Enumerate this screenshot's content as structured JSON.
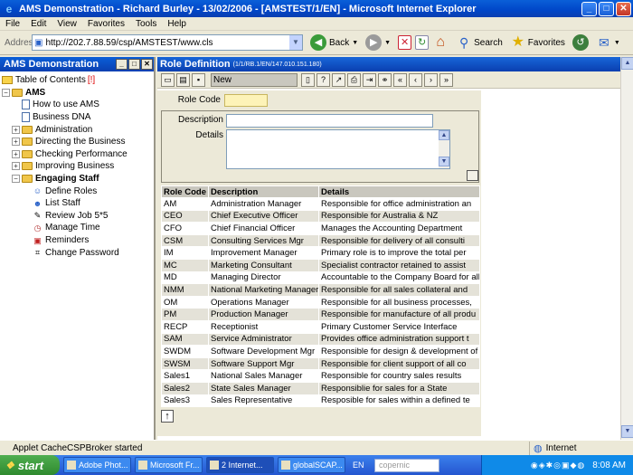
{
  "window": {
    "title": "AMS Demonstration - Richard Burley - 13/02/2006 - [AMSTEST/1/EN] - Microsoft Internet Explorer",
    "min": "_",
    "max": "□",
    "close": "✕"
  },
  "menu": [
    "File",
    "Edit",
    "View",
    "Favorites",
    "Tools",
    "Help"
  ],
  "address": {
    "label": "Address",
    "url": "http://202.7.88.59/csp/AMSTEST/www.cls"
  },
  "toolbar": {
    "back": "Back",
    "search": "Search",
    "favorites": "Favorites"
  },
  "left_pane": {
    "title": "AMS Demonstration",
    "toc_label": "Table of Contents",
    "toc_marker": "[!]",
    "root": "AMS",
    "items": [
      {
        "label": "How to use AMS",
        "kind": "doc"
      },
      {
        "label": "Business DNA",
        "kind": "doc"
      },
      {
        "label": "Administration",
        "kind": "folder"
      },
      {
        "label": "Directing the Business",
        "kind": "folder"
      },
      {
        "label": "Checking Performance",
        "kind": "folder"
      },
      {
        "label": "Improving Business",
        "kind": "folder"
      }
    ],
    "open_section": "Engaging Staff",
    "sub_items": [
      "Define Roles",
      "List Staff",
      "Review Job 5*5",
      "Manage Time",
      "Reminders",
      "Change Password"
    ]
  },
  "role_def": {
    "title": "Role Definition",
    "subtitle": "(1/1/RB.1/EN/147.010.151.180)",
    "mode": "New",
    "fields": {
      "role_code": "Role Code",
      "description": "Description",
      "details": "Details"
    },
    "columns": [
      "Role Code",
      "Description",
      "Details"
    ],
    "rows": [
      [
        "AM",
        "Administration Manager",
        "Responsible for office administration an"
      ],
      [
        "CEO",
        "Chief Executive Officer",
        "Responsible for Australia & NZ"
      ],
      [
        "CFO",
        "Chief Financial Officer",
        "Manages the Accounting Department"
      ],
      [
        "CSM",
        "Consulting Services Mgr",
        "Responsible for delivery of all consulti"
      ],
      [
        "IM",
        "Improvement Manager",
        "Primary role is to improve the total per"
      ],
      [
        "MC",
        "Marketing Consultant",
        "Specialist contractor retained to assist"
      ],
      [
        "MD",
        "Managing Director",
        "Accountable to the Company Board for all"
      ],
      [
        "NMM",
        "National Marketing Manager",
        "Responsible for all sales collateral and"
      ],
      [
        "OM",
        "Operations Manager",
        "Responsible for all business processes,"
      ],
      [
        "PM",
        "Production Manager",
        "Responsible for manufacture of all produ"
      ],
      [
        "RECP",
        "Receptionist",
        "Primary Customer Service Interface"
      ],
      [
        "SAM",
        "Service Administrator",
        "Provides office administration support t"
      ],
      [
        "SWDM",
        "Software Development Mgr",
        "Responsible for design & development of"
      ],
      [
        "SWSM",
        "Software Support Mgr",
        "Responsible for client support of all co"
      ],
      [
        "Sales1",
        "National Sales Manager",
        "Responsible for country sales results"
      ],
      [
        "Sales2",
        "State Sales Manager",
        "Responsiblie for sales for a State"
      ],
      [
        "Sales3",
        "Sales Representative",
        "Resposible for sales within a defined te"
      ]
    ]
  },
  "status": {
    "text": "Applet CacheCSPBroker started",
    "zone": "Internet"
  },
  "taskbar": {
    "start": "start",
    "tasks": [
      "Adobe Phot...",
      "Microsoft Fr...",
      "2 Internet...",
      "globalSCAP..."
    ],
    "lang": "EN",
    "search_placeholder": "copernic",
    "clock": "8:08 AM"
  }
}
